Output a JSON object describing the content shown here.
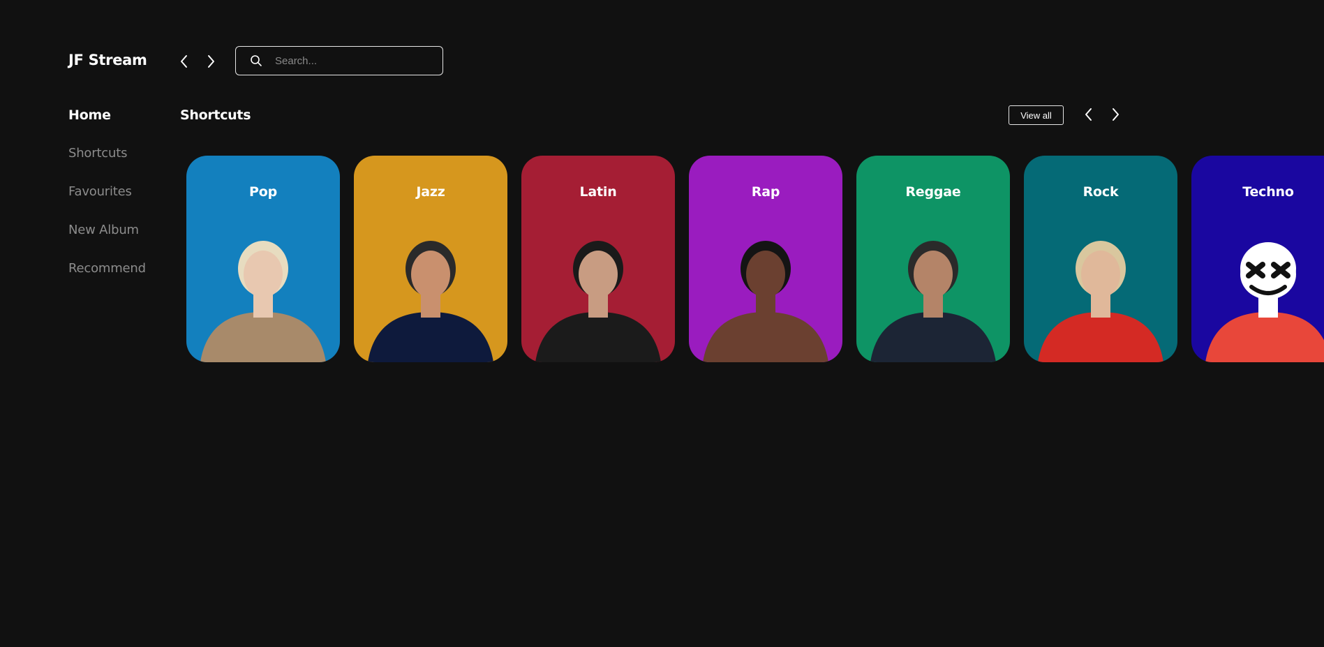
{
  "brand": "JF Stream",
  "search": {
    "placeholder": "Search..."
  },
  "sidebar": {
    "items": [
      {
        "label": "Home",
        "active": true
      },
      {
        "label": "Shortcuts",
        "active": false
      },
      {
        "label": "Favourites",
        "active": false
      },
      {
        "label": "New Album",
        "active": false
      },
      {
        "label": "Recommend",
        "active": false
      }
    ]
  },
  "section": {
    "title": "Shortcuts",
    "view_all_label": "View all"
  },
  "genres": [
    {
      "label": "Pop",
      "color": "#1380be",
      "skin": "#e8c8b0",
      "hair": "#e7dcc0",
      "outfit": "#a88a6a"
    },
    {
      "label": "Jazz",
      "color": "#d6971e",
      "skin": "#c9906e",
      "hair": "#2a2a2a",
      "outfit": "#0e1a3c"
    },
    {
      "label": "Latin",
      "color": "#a51e34",
      "skin": "#c89c82",
      "hair": "#1a1a1a",
      "outfit": "#1b1b1b"
    },
    {
      "label": "Rap",
      "color": "#9a1cbf",
      "skin": "#6b4030",
      "hair": "#141414",
      "outfit": "#6b4030"
    },
    {
      "label": "Reggae",
      "color": "#0e9465",
      "skin": "#b48468",
      "hair": "#2a2a2a",
      "outfit": "#1c2535"
    },
    {
      "label": "Rock",
      "color": "#056a76",
      "skin": "#e0b89a",
      "hair": "#d9c79e",
      "outfit": "#d42a24"
    },
    {
      "label": "Techno",
      "color": "#1a07a0",
      "skin": "#ffffff",
      "hair": "#ffffff",
      "outfit": "#e8473a"
    }
  ],
  "icons": {
    "history_back": "chevron-left-icon",
    "history_forward": "chevron-right-icon",
    "search": "search-icon",
    "carousel_prev": "chevron-left-icon",
    "carousel_next": "chevron-right-icon"
  }
}
